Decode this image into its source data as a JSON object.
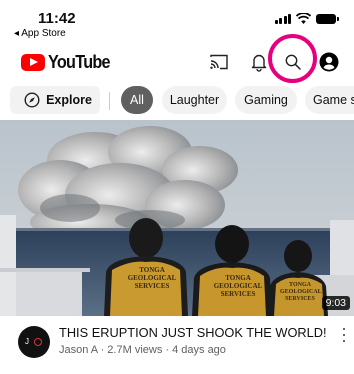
{
  "status_bar": {
    "time": "11:42",
    "back_app": "◂ App Store"
  },
  "header": {
    "logo_text": "YouTube",
    "icons": [
      "cast-icon",
      "bell-icon",
      "search-icon",
      "account-icon"
    ],
    "highlight_color": "#e6007e"
  },
  "chips": {
    "explore": "Explore",
    "items": [
      "All",
      "Laughter",
      "Gaming",
      "Game sh"
    ]
  },
  "video": {
    "duration": "9:03",
    "title": "THIS ERUPTION JUST SHOOK THE WORLD!",
    "subtitle": "Jason A · 2.7M views · 4 days ago",
    "channel_avatar_text": "J",
    "vest_text": "TONGA\nGEOLOGICAL\nSERVICES"
  },
  "colors": {
    "brand_red": "#ff0000",
    "active_chip": "#606060",
    "chip_bg": "#f2f2f2"
  }
}
